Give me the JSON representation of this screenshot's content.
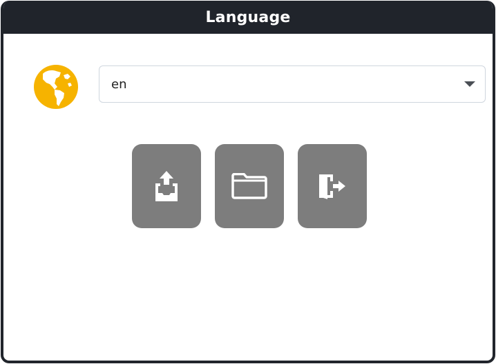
{
  "window": {
    "title": "Language"
  },
  "language": {
    "icon": "globe-icon",
    "selected": "en",
    "accent_color": "#f6b300"
  },
  "actions": [
    {
      "name": "export-button",
      "icon": "tray-upload-icon"
    },
    {
      "name": "open-folder-button",
      "icon": "folder-icon"
    },
    {
      "name": "exit-button",
      "icon": "door-exit-icon"
    }
  ],
  "colors": {
    "titlebar": "#20242b",
    "button": "#7d7d7d",
    "icon": "#ffffff"
  }
}
